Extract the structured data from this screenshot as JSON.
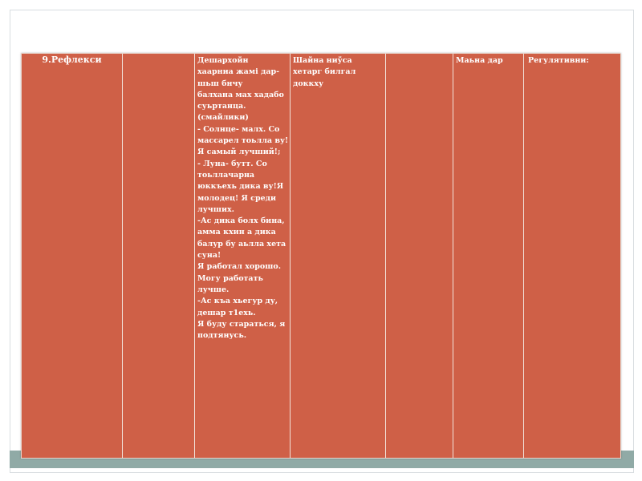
{
  "table": {
    "header": {
      "step": "9.Рефлекси",
      "col2": "",
      "col4": "Шайна ниўса хетарг билгал доккху",
      "col5": "",
      "col6": "Маьна дар",
      "col7": "Регулятивни:"
    },
    "col3_lines": [
      " Дешархойн",
      "хаарниа жамі дар-",
      "шьш бнчу",
      "балхана мах хадабо",
      "суьртанца.",
      "(смайлики)",
      "  - Солнце- малх. Со",
      "массарел тоьлла ву!",
      "Я самый лучший!;",
      "-   Луна- бутт. Со",
      "тоьллачарна",
      "юккъехь дика ву!Я",
      "молодец! Я среди",
      "лучших.",
      "-Ас дика болх бина,",
      "амма кхин а дика",
      "балур бу аьлла хета",
      "суна!",
      "Я работал хорошо.",
      "Могу работать",
      "лучше.",
      "-Ас къа хьегур ду,",
      "дешар т1ехь.",
      "Я буду стараться, я",
      "подтянусь."
    ]
  },
  "colors": {
    "cell_fill": "#cf6047",
    "grid_line": "#f2e2da",
    "bottom_bar": "#90aaa6",
    "text": "#ffffff"
  }
}
